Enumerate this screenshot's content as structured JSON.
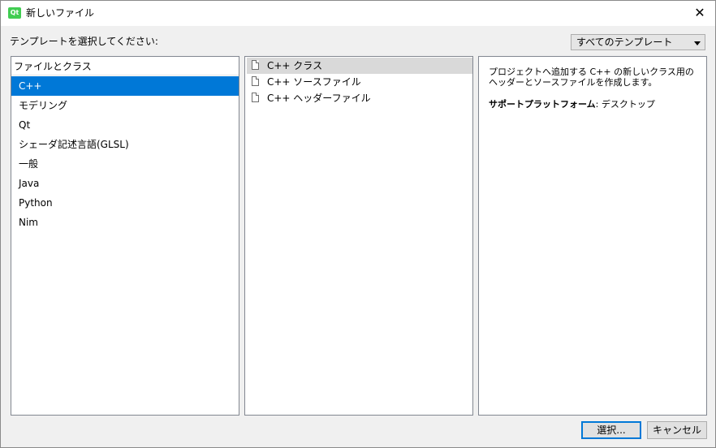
{
  "window": {
    "app_icon_text": "Qt",
    "title": "新しいファイル",
    "close_glyph": "✕"
  },
  "prompt": "テンプレートを選択してください:",
  "filter": {
    "selected": "すべてのテンプレート"
  },
  "categories": {
    "header": "ファイルとクラス",
    "items": [
      {
        "label": "C++",
        "selected": true
      },
      {
        "label": "モデリング"
      },
      {
        "label": "Qt"
      },
      {
        "label": "シェーダ記述言語(GLSL)"
      },
      {
        "label": "一般"
      },
      {
        "label": "Java"
      },
      {
        "label": "Python"
      },
      {
        "label": "Nim"
      }
    ]
  },
  "templates": {
    "items": [
      {
        "label": "C++ クラス",
        "selected": true,
        "icon": "file-icon"
      },
      {
        "label": "C++ ソースファイル",
        "icon": "file-icon"
      },
      {
        "label": "C++ ヘッダーファイル",
        "icon": "file-icon"
      }
    ]
  },
  "details": {
    "description": "プロジェクトへ追加する C++ の新しいクラス用のヘッダーとソースファイルを作成します。",
    "platform_label": "サポートプラットフォーム",
    "platform_value": ": デスクトップ"
  },
  "buttons": {
    "choose": "選択...",
    "cancel": "キャンセル"
  }
}
